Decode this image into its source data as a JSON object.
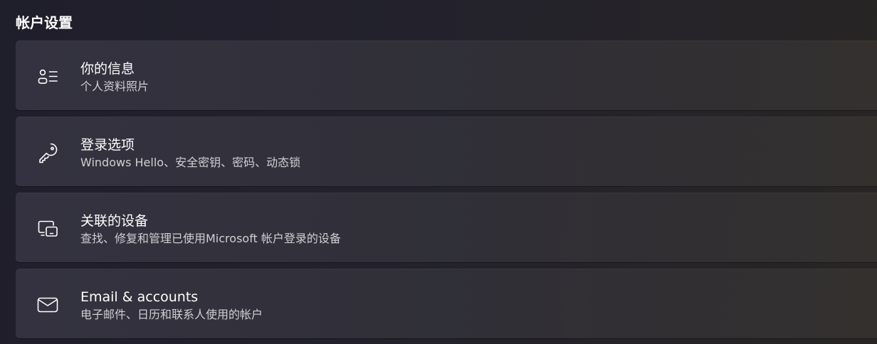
{
  "section": {
    "title": "帐户设置"
  },
  "cards": [
    {
      "icon": "person-list-icon",
      "title": "你的信息",
      "subtitle": "个人资料照片"
    },
    {
      "icon": "key-icon",
      "title": "登录选项",
      "subtitle": "Windows Hello、安全密钥、密码、动态锁"
    },
    {
      "icon": "linked-devices-icon",
      "title": "关联的设备",
      "subtitle": "查找、修复和管理已使用Microsoft 帐户登录的设备"
    },
    {
      "icon": "mail-icon",
      "title": "Email & accounts",
      "subtitle": "电子邮件、日历和联系人使用的帐户"
    }
  ],
  "colors": {
    "text_primary": "#ffffff",
    "text_secondary": "#cfcfd3",
    "card_background": "#33323c"
  }
}
